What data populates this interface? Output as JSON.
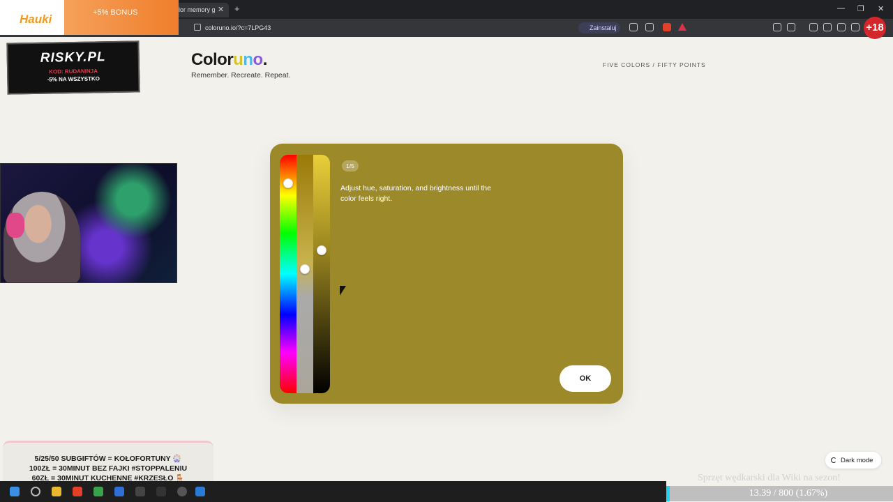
{
  "browser": {
    "tab_title": "lor memory g",
    "url": "coloruno.io/?c=7LPG43",
    "install_label": "Zainstaluj"
  },
  "overlay": {
    "bonus_logo": "Hauki",
    "bonus_text": "+5% BONUS",
    "risky_title": "RISKY.PL",
    "risky_code": "KOD: RUDANINJA",
    "risky_promo": "-5% NA WSZYSTKO",
    "subs_lines": [
      "5/25/50 SUBGIFTÓW = KOŁOFORTUNY 🎡",
      "100ZŁ = 30MINUT BEZ FAJKI #STOPPALENIU",
      "60ZŁ = 30MINUT KUCHENNE #KRZESŁO 🪑"
    ],
    "stream_line": "Sprzęt wędkarski dla Wiki na sezon!",
    "progress_text": "13.39 / 800 (1.67%)",
    "progress_fraction": 0.0167,
    "badge_18": "+18"
  },
  "app": {
    "logo": {
      "part1": "Color",
      "part2": "u",
      "part3": "n",
      "part4": "o",
      "part5": "."
    },
    "tagline": "Remember. Recreate. Repeat.",
    "nav_sub": "FIVE COLORS / FIFTY POINTS",
    "step": "1/5",
    "instruction": "Adjust hue, saturation, and brightness until the color feels right.",
    "ok_label": "OK",
    "dark_mode_label": "Dark mode",
    "card_color": "#9c8a2a",
    "knob_levels": {
      "hue": 0.12,
      "saturation": 0.48,
      "brightness": 0.4
    }
  }
}
